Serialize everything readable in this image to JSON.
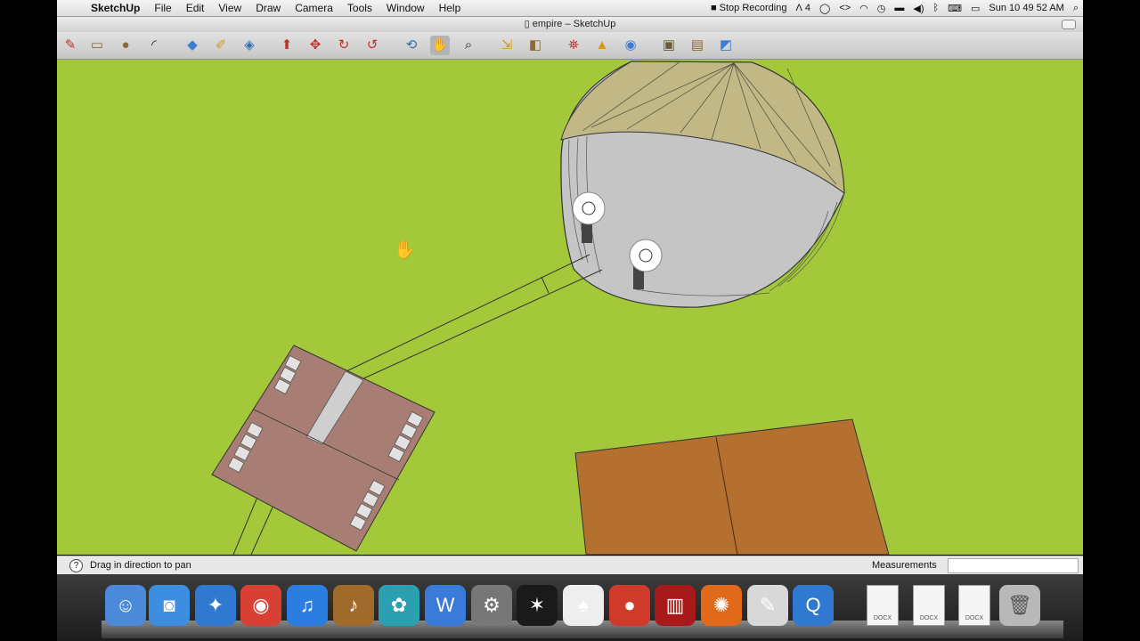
{
  "menubar": {
    "apple": "",
    "items": [
      "SketchUp",
      "File",
      "Edit",
      "View",
      "Draw",
      "Camera",
      "Tools",
      "Window",
      "Help"
    ],
    "recording": "Stop Recording",
    "adobe_count": "4",
    "clock": "Sun 10 49 52 AM"
  },
  "window": {
    "title": "empire – SketchUp"
  },
  "toolbar": {
    "tools": [
      {
        "name": "pencil-icon",
        "glyph": "✎",
        "color": "#c0302a"
      },
      {
        "name": "rectangle-icon",
        "glyph": "▭",
        "color": "#8a6a3a"
      },
      {
        "name": "circle-icon",
        "glyph": "●",
        "color": "#8a6a3a"
      },
      {
        "name": "arc-icon",
        "glyph": "◜",
        "color": "#222"
      },
      {
        "name": "eraser-icon",
        "glyph": "◆",
        "color": "#3c7fd0"
      },
      {
        "name": "tape-measure-icon",
        "glyph": "✐",
        "color": "#d49a10"
      },
      {
        "name": "paint-bucket-icon",
        "glyph": "◈",
        "color": "#2f6fb0"
      },
      {
        "name": "push-pull-icon",
        "glyph": "⬆",
        "color": "#c0302a"
      },
      {
        "name": "move-icon",
        "glyph": "✥",
        "color": "#c0302a"
      },
      {
        "name": "rotate-icon",
        "glyph": "↻",
        "color": "#c0302a"
      },
      {
        "name": "offset-icon",
        "glyph": "↺",
        "color": "#c0302a"
      },
      {
        "name": "orbit-icon",
        "glyph": "⟲",
        "color": "#2f6fb0"
      },
      {
        "name": "pan-icon",
        "glyph": "✋",
        "color": "#222"
      },
      {
        "name": "zoom-icon",
        "glyph": "⌕",
        "color": "#222"
      },
      {
        "name": "zoom-extents-icon",
        "glyph": "⇲",
        "color": "#d49a10"
      },
      {
        "name": "previous-view-icon",
        "glyph": "◧",
        "color": "#8a6a3a"
      },
      {
        "name": "add-location-icon",
        "glyph": "⛯",
        "color": "#c0302a"
      },
      {
        "name": "toggle-terrain-icon",
        "glyph": "▲",
        "color": "#d49a10"
      },
      {
        "name": "geo-photo-icon",
        "glyph": "◉",
        "color": "#3c7fd0"
      },
      {
        "name": "get-models-icon",
        "glyph": "▣",
        "color": "#6a5a3a"
      },
      {
        "name": "share-model-icon",
        "glyph": "▤",
        "color": "#8a6a3a"
      },
      {
        "name": "share-component-icon",
        "glyph": "◩",
        "color": "#3c7fd0"
      }
    ]
  },
  "status": {
    "help_glyph": "?",
    "message": "Drag in direction to pan",
    "measurements_label": "Measurements",
    "measurements_value": ""
  },
  "dock": {
    "apps": [
      {
        "name": "finder-icon",
        "glyph": "☺",
        "bg": "#4a8ad8"
      },
      {
        "name": "facetime-icon",
        "glyph": "◙",
        "bg": "#3d8de0"
      },
      {
        "name": "safari-icon",
        "glyph": "✦",
        "bg": "#2f7ad0"
      },
      {
        "name": "chrome-icon",
        "glyph": "◉",
        "bg": "#d94035"
      },
      {
        "name": "itunes-icon",
        "glyph": "♫",
        "bg": "#2b7ee0"
      },
      {
        "name": "garageband-icon",
        "glyph": "♪",
        "bg": "#a06a2a"
      },
      {
        "name": "game-icon",
        "glyph": "✿",
        "bg": "#2aa0b0"
      },
      {
        "name": "word-icon",
        "glyph": "W",
        "bg": "#3a7ad8"
      },
      {
        "name": "system-preferences-icon",
        "glyph": "⚙",
        "bg": "#777777"
      },
      {
        "name": "motion-icon",
        "glyph": "✶",
        "bg": "#1a1a1a"
      },
      {
        "name": "solitaire-icon",
        "glyph": "♠",
        "bg": "#eeeeee"
      },
      {
        "name": "angry-birds-icon",
        "glyph": "●",
        "bg": "#d03a2a"
      },
      {
        "name": "photo-booth-icon",
        "glyph": "▥",
        "bg": "#a81a1a"
      },
      {
        "name": "screenflow-icon",
        "glyph": "✺",
        "bg": "#e06a1a"
      },
      {
        "name": "sketchup-icon",
        "glyph": "✎",
        "bg": "#d8d8d8"
      },
      {
        "name": "quicktime-icon",
        "glyph": "Q",
        "bg": "#2f7ad0"
      }
    ],
    "docs": [
      {
        "name": "docx-file-icon",
        "label": "DOCX"
      },
      {
        "name": "docx-file-icon",
        "label": "DOCX"
      },
      {
        "name": "docx-file-icon",
        "label": "DOCX"
      }
    ],
    "trash": "trash-icon"
  }
}
